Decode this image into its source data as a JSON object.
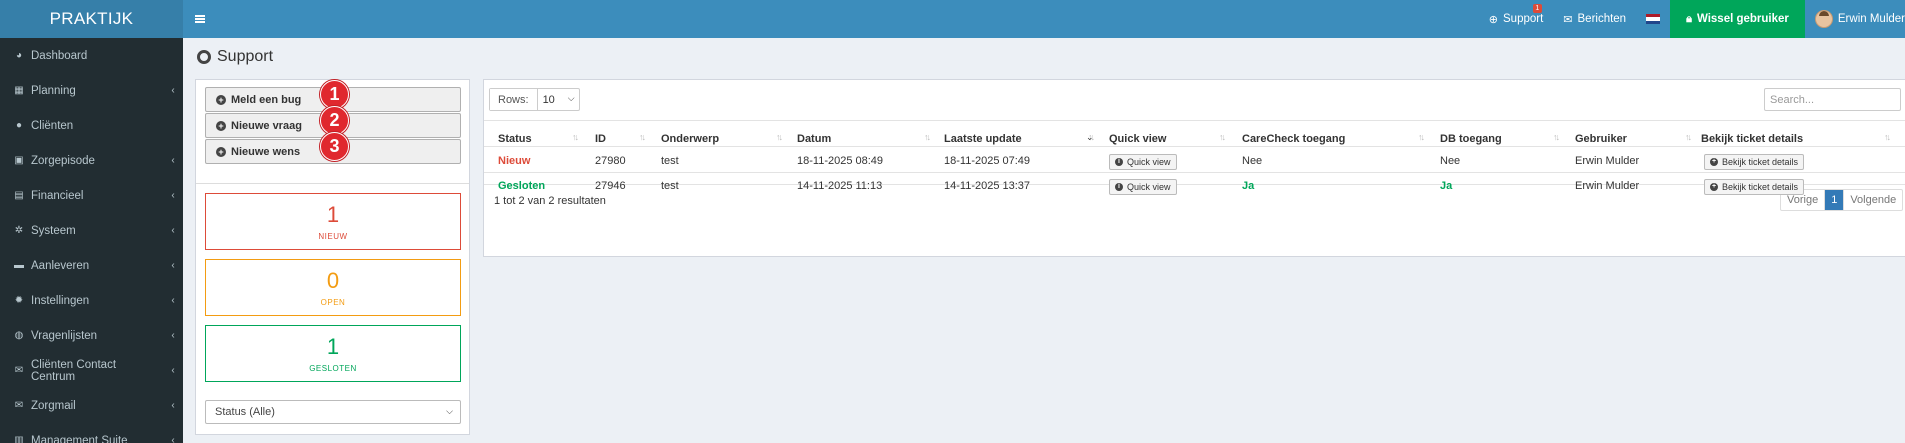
{
  "app": {
    "title": "PRAKTIJK"
  },
  "topbar": {
    "support_label": "Support",
    "support_badge": "1",
    "messages_label": "Berichten",
    "switch_user_label": "Wissel gebruiker",
    "user_name": "Erwin Mulder",
    "colors": {
      "bar": "#3c8dbc",
      "logo": "#367fa9",
      "switch": "#00a65a"
    }
  },
  "sidebar": {
    "items": [
      {
        "label": "Dashboard",
        "icon": "dashboard-icon",
        "expandable": false
      },
      {
        "label": "Planning",
        "icon": "calendar-icon",
        "expandable": true
      },
      {
        "label": "Cliënten",
        "icon": "user-icon",
        "expandable": false
      },
      {
        "label": "Zorgepisode",
        "icon": "briefcase-icon",
        "expandable": true
      },
      {
        "label": "Financieel",
        "icon": "book-icon",
        "expandable": true
      },
      {
        "label": "Systeem",
        "icon": "cogs-icon",
        "expandable": true
      },
      {
        "label": "Aanleveren",
        "icon": "truck-icon",
        "expandable": true
      },
      {
        "label": "Instellingen",
        "icon": "gear-icon",
        "expandable": true
      },
      {
        "label": "Vragenlijsten",
        "icon": "globe-icon",
        "expandable": true
      },
      {
        "label": "Cliënten Contact Centrum",
        "icon": "envelope-icon",
        "expandable": true
      },
      {
        "label": "Zorgmail",
        "icon": "envelope-icon",
        "expandable": true
      },
      {
        "label": "Management Suite",
        "icon": "chart-icon",
        "expandable": true
      }
    ]
  },
  "page": {
    "title": "Support"
  },
  "actions": {
    "report_bug": "Meld een bug",
    "new_question": "Nieuwe vraag",
    "new_wish": "Nieuwe wens",
    "markers": [
      "1",
      "2",
      "3"
    ]
  },
  "stats": [
    {
      "count": "1",
      "label": "NIEUW",
      "color": "#dd4b39"
    },
    {
      "count": "0",
      "label": "OPEN",
      "color": "#f39c12"
    },
    {
      "count": "1",
      "label": "GESLOTEN",
      "color": "#00a65a"
    }
  ],
  "filter": {
    "status_selected": "Status (Alle)"
  },
  "table": {
    "rows_label": "Rows:",
    "rows_value": "10",
    "search_placeholder": "Search...",
    "columns": [
      "Status",
      "ID",
      "Onderwerp",
      "Datum",
      "Laatste update",
      "Quick view",
      "CareCheck toegang",
      "DB toegang",
      "Gebruiker",
      "Bekijk ticket details"
    ],
    "rows": [
      {
        "status": "Nieuw",
        "status_color": "#dd4b39",
        "id": "27980",
        "subject": "test",
        "date": "18-11-2025 08:49",
        "updated": "18-11-2025 07:49",
        "quick_view": "Quick view",
        "carecheck": "Nee",
        "carecheck_color": "#333333",
        "db": "Nee",
        "db_color": "#333333",
        "user": "Erwin Mulder",
        "details": "Bekijk ticket details"
      },
      {
        "status": "Gesloten",
        "status_color": "#00a65a",
        "id": "27946",
        "subject": "test",
        "date": "14-11-2025 11:13",
        "updated": "14-11-2025 13:37",
        "quick_view": "Quick view",
        "carecheck": "Ja",
        "carecheck_color": "#00a65a",
        "db": "Ja",
        "db_color": "#00a65a",
        "user": "Erwin Mulder",
        "details": "Bekijk ticket details"
      }
    ],
    "result_info": "1 tot 2 van 2 resultaten",
    "pager": {
      "prev": "Vorige",
      "current": "1",
      "next": "Volgende"
    }
  }
}
